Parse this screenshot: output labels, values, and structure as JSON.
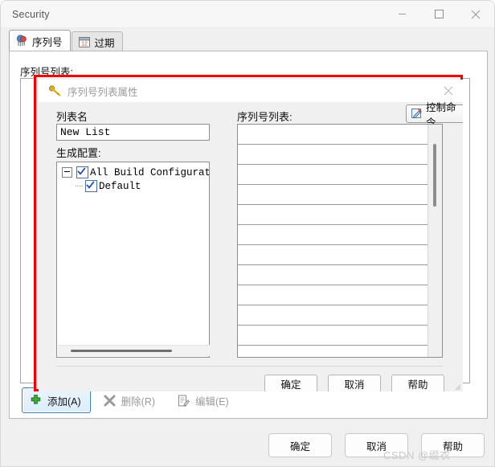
{
  "window": {
    "title": "Security",
    "controls": {
      "minimize_label": "Minimize",
      "maximize_label": "Maximize",
      "close_label": "Close"
    }
  },
  "tabs": [
    {
      "label": "序列号",
      "icon": "dice-icon",
      "active": true
    },
    {
      "label": "过期",
      "icon": "calendar-icon",
      "active": false
    }
  ],
  "background_panel": {
    "list_label": "序列号列表:"
  },
  "action_toolbar": {
    "buttons": [
      {
        "label": "添加(A)",
        "accesskey": "A",
        "icon": "plus-icon",
        "state": "focused"
      },
      {
        "label": "删除(R)",
        "accesskey": "R",
        "icon": "x-mark-icon",
        "state": "disabled"
      },
      {
        "label": "编辑(E)",
        "accesskey": "E",
        "icon": "edit-note-icon",
        "state": "disabled"
      }
    ]
  },
  "window_footer": {
    "buttons": [
      {
        "label": "确定"
      },
      {
        "label": "取消"
      },
      {
        "label": "帮助"
      }
    ]
  },
  "dialog": {
    "title": "序列号列表属性",
    "title_icon": "key-icon",
    "close_label": "×",
    "highlight_color": "#f40000",
    "list_name": {
      "label": "列表名",
      "value": "New List",
      "placeholder": ""
    },
    "build_config": {
      "label": "生成配置:",
      "tree": [
        {
          "label": "All Build Configuration",
          "checked": true,
          "expanded": true,
          "level": 0
        },
        {
          "label": "Default",
          "checked": true,
          "level": 1
        }
      ],
      "hscrollbar": true
    },
    "sequence_list": {
      "label": "序列号列表:",
      "rows": [
        "",
        "",
        "",
        "",
        "",
        "",
        "",
        "",
        "",
        "",
        "",
        ""
      ],
      "vscrollbar": true
    },
    "command_dropdown": {
      "label": "控制命令",
      "icon": "pencil-edit-icon",
      "caret": "chevron-down-icon"
    },
    "footer": {
      "buttons": [
        {
          "label": "确定"
        },
        {
          "label": "取消"
        },
        {
          "label": "帮助"
        }
      ]
    }
  },
  "watermark": {
    "text": "CSDN @缀衣"
  }
}
